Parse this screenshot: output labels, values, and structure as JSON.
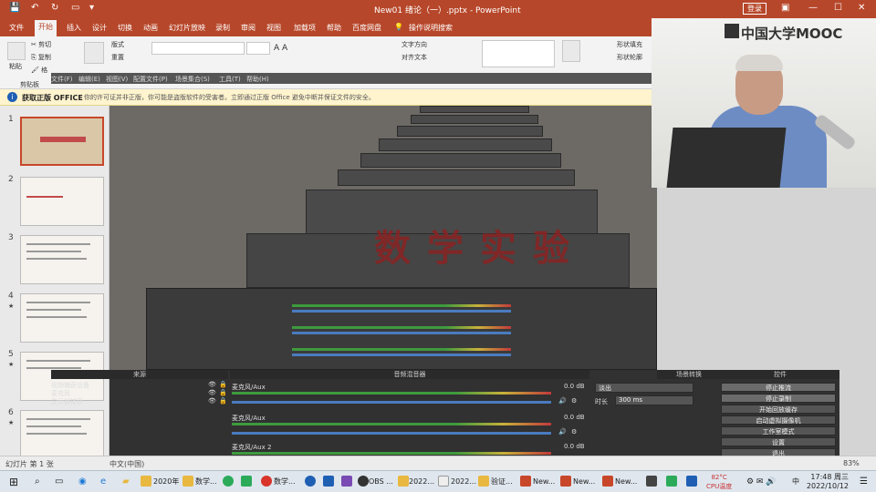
{
  "titlebar": {
    "title": "New01 绪论（一）.pptx - PowerPoint",
    "login": "登录",
    "min": "—",
    "max": "☐",
    "close": "✕"
  },
  "ribbon_tabs": [
    "文件",
    "开始",
    "插入",
    "设计",
    "切换",
    "动画",
    "幻灯片放映",
    "录制",
    "审阅",
    "视图",
    "加载项",
    "帮助",
    "百度网盘",
    "操作说明搜索"
  ],
  "ribbon": {
    "paste": "粘贴",
    "cut": "剪切",
    "copy": "复制",
    "format_painter": "格",
    "clipboard_group": "剪贴板",
    "layout": "版式",
    "reset": "重置",
    "text_direction": "文字方向",
    "align_text": "对齐文本",
    "shape_fill": "形状填充",
    "shape_outline": "形状轮廓"
  },
  "infobar": {
    "title": "获取正版 OFFICE",
    "message": "你的许可证并非正版，你可能是盗版软件的受害者。立即通过正版 Office 避免中断并保证文件的安全。"
  },
  "slides": [
    {
      "num": "1"
    },
    {
      "num": "2"
    },
    {
      "num": "3"
    },
    {
      "num": "4",
      "star": "★"
    },
    {
      "num": "5",
      "star": "★"
    },
    {
      "num": "6",
      "star": "★"
    }
  ],
  "obs": {
    "menubar": [
      "文件(F)",
      "编辑(E)",
      "视图(V)",
      "配置文件(P)",
      "场景集合(S)",
      "工具(T)",
      "帮助(H)"
    ],
    "panels": {
      "sources": "来源",
      "mixer": "音频混音器",
      "transitions": "场景转换",
      "controls": "控件"
    },
    "sources": [
      "视频捕获设备",
      "麦克风",
      "显示器捕获"
    ],
    "mixer_tracks": [
      {
        "name": "麦克风/Aux",
        "db": "0.0 dB"
      },
      {
        "name": "麦克风/Aux",
        "db": "0.0 dB"
      },
      {
        "name": "麦克风/Aux 2",
        "db": "0.0 dB"
      }
    ],
    "transition": {
      "type": "淡出",
      "duration_label": "时长",
      "duration": "300 ms"
    },
    "controls": [
      "停止推流",
      "停止录制",
      "开始回放缓存",
      "启动虚拟摄像机",
      "工作室模式",
      "设置",
      "退出"
    ],
    "overlay_title": "数学实验"
  },
  "webcam": {
    "brand": "中国大学MOOC"
  },
  "statusbar": {
    "slide_info": "幻灯片 第 1 张",
    "lang": "中文(中国)",
    "zoom": "83%"
  },
  "taskbar": {
    "items": [
      {
        "label": "2020年",
        "color": "#e8b840"
      },
      {
        "label": "数学...",
        "color": "#e8b840"
      },
      {
        "label": "数学...",
        "color": "#d9342b"
      },
      {
        "label": "OBS ...",
        "color": "#333333"
      },
      {
        "label": "2022...",
        "color": "#e8b840"
      },
      {
        "label": "2022...",
        "color": "#eeeeee"
      },
      {
        "label": "验证...",
        "color": "#e8b840"
      },
      {
        "label": "New...",
        "color": "#c8472a"
      },
      {
        "label": "New...",
        "color": "#c8472a"
      },
      {
        "label": "New...",
        "color": "#c8472a"
      }
    ],
    "temp": "82°C",
    "cpu": "CPU温度",
    "time": "17:48 周三",
    "date": "2022/10/12",
    "ime": "中"
  }
}
